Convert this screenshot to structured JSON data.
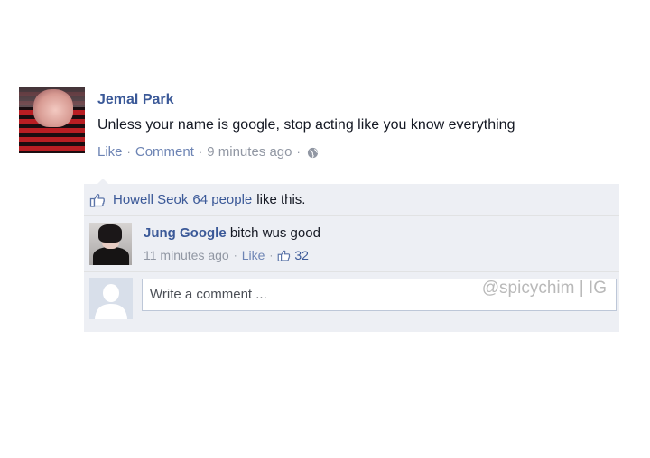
{
  "post": {
    "author": "Jemal Park",
    "message": "Unless your name is google, stop acting like you know everything",
    "like_label": "Like",
    "comment_label": "Comment",
    "time": "9 minutes ago"
  },
  "likes": {
    "liker": "Howell Seok",
    "count": "64 people",
    "suffix": "like this."
  },
  "comments": [
    {
      "author": "Jung Google",
      "text": "bitch wus good",
      "time": "11 minutes ago",
      "like_label": "Like",
      "like_count": "32"
    }
  ],
  "write_comment": {
    "placeholder": "Write a comment ..."
  },
  "watermark": "@spicychim | IG",
  "colors": {
    "link": "#3b5998",
    "meta": "#9197a3",
    "panel": "#edeff4"
  },
  "icons": [
    "globe-icon",
    "thumbs-up-icon",
    "default-avatar-icon"
  ]
}
